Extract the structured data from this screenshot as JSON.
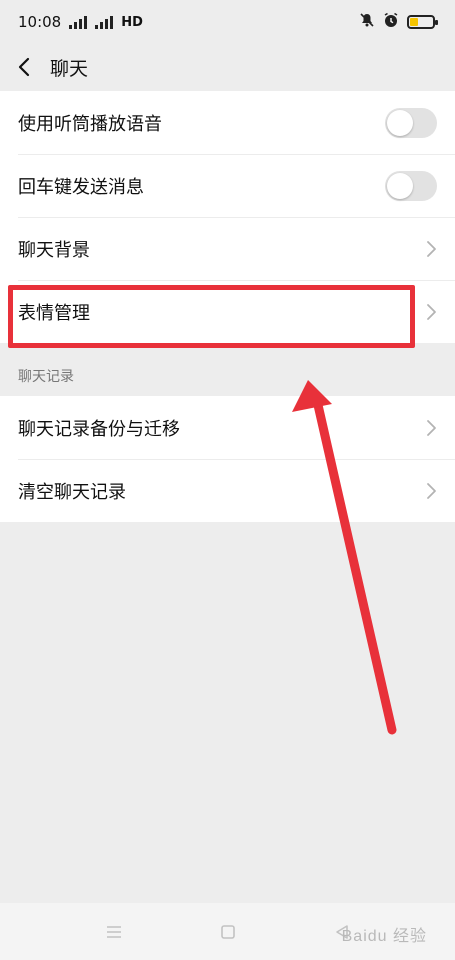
{
  "status": {
    "time": "10:08",
    "network_label": "HD",
    "battery_level": 0.35,
    "battery_color": "#f5c400"
  },
  "nav": {
    "title": "聊天",
    "back_icon": "chevron-left-icon"
  },
  "settings_group_1": [
    {
      "label": "使用听筒播放语音",
      "control": "toggle",
      "on": false
    },
    {
      "label": "回车键发送消息",
      "control": "toggle",
      "on": false
    },
    {
      "label": "聊天背景",
      "control": "chevron"
    },
    {
      "label": "表情管理",
      "control": "chevron",
      "highlighted": true
    }
  ],
  "section_chat_history": {
    "header": "聊天记录",
    "items": [
      {
        "label": "聊天记录备份与迁移",
        "control": "chevron"
      },
      {
        "label": "清空聊天记录",
        "control": "chevron"
      }
    ]
  },
  "annotation": {
    "highlight_color": "#e8313a",
    "arrow_color": "#e8313a"
  },
  "watermark": "Baidu 经验",
  "colors": {
    "background": "#ededed",
    "row_background": "#ffffff",
    "toggle_off": "#e2e2e2"
  }
}
